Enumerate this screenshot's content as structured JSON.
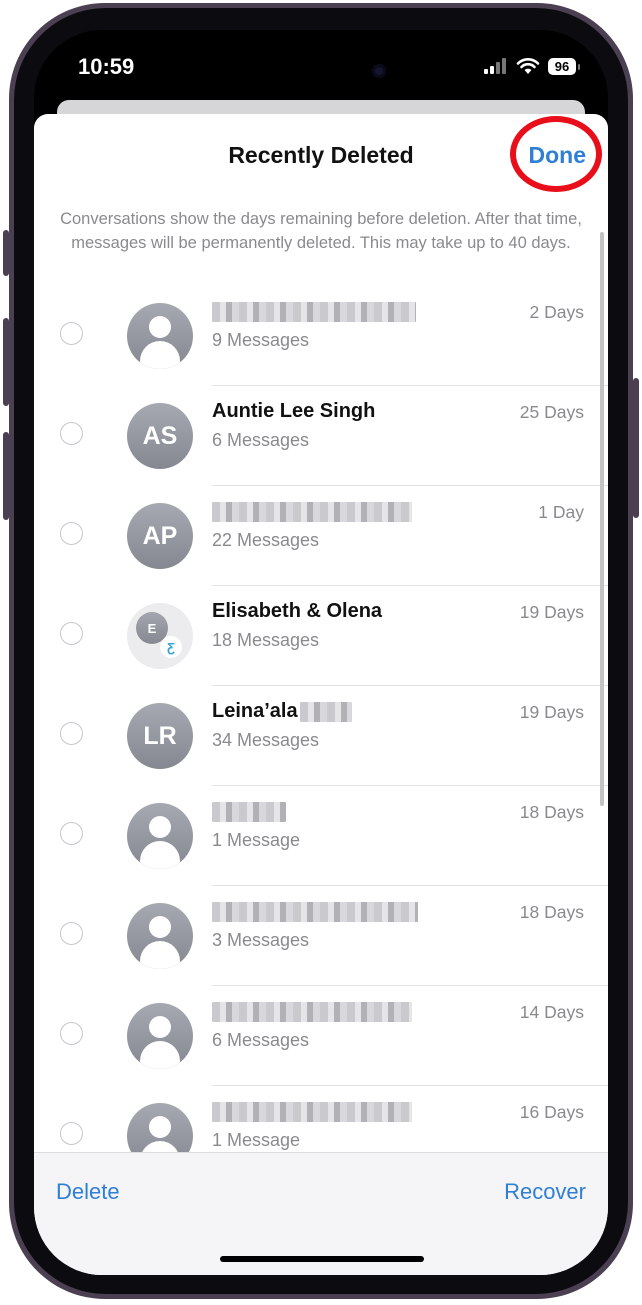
{
  "status_bar": {
    "time": "10:59",
    "battery": "96"
  },
  "sheet": {
    "title": "Recently Deleted",
    "done_label": "Done",
    "info": "Conversations show the days remaining before deletion. After that time, messages will be permanently deleted. This may take up to 40 days."
  },
  "conversations": [
    {
      "name": "",
      "name_blurred": true,
      "messages": "9 Messages",
      "days": "2 Days",
      "avatar": "person-icon"
    },
    {
      "name": "Auntie Lee Singh",
      "messages": "6 Messages",
      "days": "25 Days",
      "avatar_initials": "AS"
    },
    {
      "name": "",
      "name_blurred": true,
      "messages": "22 Messages",
      "days": "1 Day",
      "avatar_initials": "AP"
    },
    {
      "name": "Elisabeth & Olena",
      "messages": "18 Messages",
      "days": "19 Days",
      "avatar": "group-avatar",
      "group_initial": "E"
    },
    {
      "name": "Leina’ala",
      "name_partially_blurred": true,
      "messages": "34 Messages",
      "days": "19 Days",
      "avatar_initials": "LR"
    },
    {
      "name": "",
      "name_blurred": true,
      "messages": "1 Message",
      "days": "18 Days",
      "avatar": "person-icon"
    },
    {
      "name": "",
      "name_blurred": true,
      "messages": "3 Messages",
      "days": "18 Days",
      "avatar": "person-icon"
    },
    {
      "name": "",
      "name_blurred": true,
      "messages": "6 Messages",
      "days": "14 Days",
      "avatar": "person-icon"
    },
    {
      "name": "",
      "name_blurred": true,
      "messages": "1 Message",
      "days": "16 Days",
      "avatar": "person-icon"
    }
  ],
  "toolbar": {
    "delete_label": "Delete",
    "recover_label": "Recover"
  },
  "colors": {
    "accent": "#2f7fd4",
    "highlight_ring": "#e80f1b"
  }
}
